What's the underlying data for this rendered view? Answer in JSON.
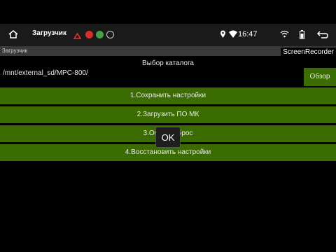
{
  "statusbar": {
    "app_title": "Загрузчик",
    "time": "16:47",
    "icons": [
      "home-icon",
      "recorder-notif-icon",
      "red-notif-icon",
      "green-notif-icon",
      "settings-notif-icon",
      "location-icon",
      "wifi-icon",
      "wifi-alt-icon",
      "battery-icon",
      "back-icon"
    ]
  },
  "appbar": {
    "label": "Загрузчик",
    "recorder": "ScreenRecorder"
  },
  "catalog": {
    "title": "Выбор каталога",
    "path": "/mnt/external_sd/MPC-800/",
    "browse_label": "Обзор"
  },
  "menu": {
    "items": [
      {
        "label": "1.Сохранить настройки"
      },
      {
        "label": "2.Загрузить ПО МК"
      },
      {
        "label": "3.Общий сброс"
      },
      {
        "label": "4.Восстановить настройки"
      }
    ]
  },
  "toast": {
    "label": "OK"
  },
  "colors": {
    "button_green": "#3b6c01",
    "background": "#000000",
    "statusbar": "#1a1a1a"
  }
}
